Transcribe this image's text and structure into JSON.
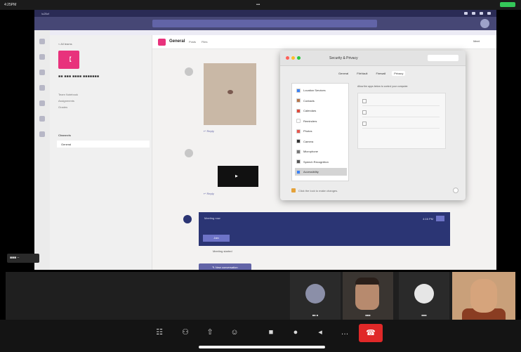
{
  "status_bar": {
    "time": "4:25PM",
    "center_text": "•••",
    "battery_color": "#34c759"
  },
  "teams": {
    "top_color": "#464775",
    "rail_icons": [
      "activity-icon",
      "chat-icon",
      "teams-icon",
      "calendar-icon",
      "calls-icon",
      "files-icon",
      "more-icon"
    ],
    "back_link": "< All teams",
    "team_tile_text": "【",
    "team_name": "■■ ■■■ ■■■■ ■■■■■■■",
    "links": [
      "Team Notebook",
      "Assignments",
      "Grades"
    ],
    "channels_heading": "Channels",
    "selected_channel": "General",
    "channel_name": "General",
    "tabs": [
      "Posts",
      "Files"
    ],
    "meeting_label": "Meet",
    "reply_label": "↩ Reply",
    "recording_play": "▶",
    "meeting_title": "Meeting now",
    "meeting_time": "4:16 PM",
    "join_label": "Join",
    "meeting_ended_text": "Meeting started",
    "new_conversation": "✎ New conversation"
  },
  "prefs": {
    "title": "Security & Privacy",
    "tabs": [
      "General",
      "FileVault",
      "Firewall",
      "Privacy"
    ],
    "active_tab": 3,
    "items": [
      {
        "label": "Location Services",
        "icon": "location-icon",
        "color": "#3b82f6"
      },
      {
        "label": "Contacts",
        "icon": "contacts-icon",
        "color": "#b8754a"
      },
      {
        "label": "Calendars",
        "icon": "calendar-icon",
        "color": "#e04a3a"
      },
      {
        "label": "Reminders",
        "icon": "reminders-icon",
        "color": "#ffffff"
      },
      {
        "label": "Photos",
        "icon": "photos-icon",
        "color": "#e8574d"
      },
      {
        "label": "Camera",
        "icon": "camera-icon",
        "color": "#333333"
      },
      {
        "label": "Microphone",
        "icon": "microphone-icon",
        "color": "#777777"
      },
      {
        "label": "Speech Recognition",
        "icon": "speech-icon",
        "color": "#555555"
      },
      {
        "label": "Accessibility",
        "icon": "accessibility-icon",
        "color": "#3b82f6"
      }
    ],
    "selected_index": 8,
    "pane_prompt": "Allow the apps below to control your computer.",
    "lock_text": "Click the lock to make changes."
  },
  "bottom_chip": "■■■ –",
  "gallery": {
    "participants": [
      {
        "name": "■■ ■",
        "type": "avatar",
        "color": "#8b8fa8"
      },
      {
        "name": "■■■",
        "type": "video"
      },
      {
        "name": "■■■",
        "type": "avatar",
        "color": "#e6e6e6"
      }
    ]
  },
  "toolbar": {
    "buttons": [
      {
        "name": "chat-icon",
        "glyph": "☷"
      },
      {
        "name": "participants-icon",
        "glyph": "⚇"
      },
      {
        "name": "share-screen-icon",
        "glyph": "⇧"
      },
      {
        "name": "reactions-icon",
        "glyph": "☺"
      },
      {
        "name": "video-icon",
        "glyph": "■"
      },
      {
        "name": "mic-icon",
        "glyph": "●"
      },
      {
        "name": "speaker-icon",
        "glyph": "◂"
      },
      {
        "name": "more-icon",
        "glyph": "…"
      }
    ],
    "end_glyph": "☎",
    "end_color": "#e02828"
  }
}
